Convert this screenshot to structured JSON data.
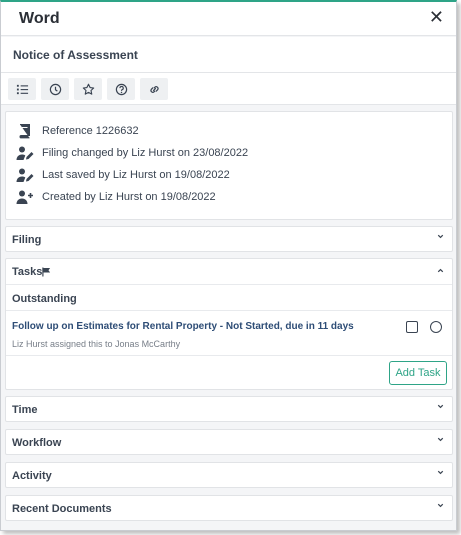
{
  "window": {
    "title": "Word",
    "close_icon": "close-icon"
  },
  "document": {
    "title": "Notice of Assessment"
  },
  "toolbar": {
    "buttons": [
      {
        "icon": "list-icon"
      },
      {
        "icon": "clock-icon"
      },
      {
        "icon": "star-icon"
      },
      {
        "icon": "help-icon"
      },
      {
        "icon": "link-icon"
      }
    ]
  },
  "info": {
    "reference": "Reference 1226632",
    "filing_changed": "Filing changed by Liz Hurst on 23/08/2022",
    "last_saved": "Last saved by Liz Hurst on 19/08/2022",
    "created": "Created by Liz Hurst on 19/08/2022"
  },
  "sections": {
    "filing": "Filing",
    "tasks": "Tasks",
    "time": "Time",
    "workflow": "Workflow",
    "activity": "Activity",
    "recent_documents": "Recent Documents"
  },
  "tasks": {
    "outstanding_label": "Outstanding",
    "items": [
      {
        "title": "Follow up on Estimates for Rental Property - Not Started, due in 11 days",
        "subtitle": "Liz Hurst assigned this to Jonas McCarthy"
      }
    ],
    "add_label": "Add Task"
  },
  "colors": {
    "accent": "#2ea487",
    "task_link": "#2e4d76",
    "text": "#3a4452"
  }
}
